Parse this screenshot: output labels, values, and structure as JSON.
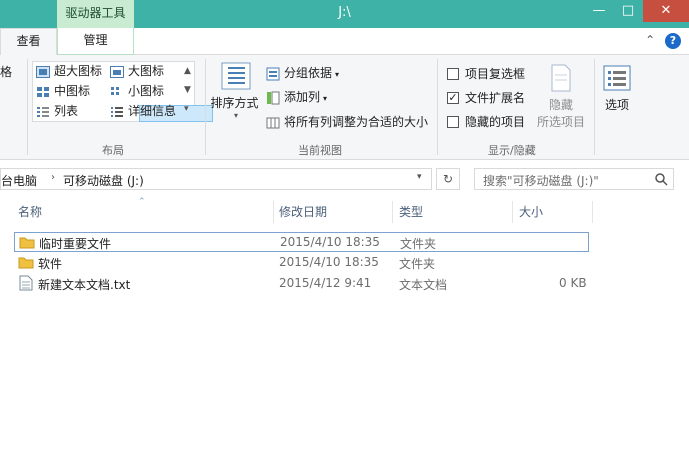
{
  "window": {
    "context_tab": "驱动器工具",
    "title": "J:\\",
    "minimize": "—",
    "maximize": "□",
    "close": "✕"
  },
  "tabs": [
    {
      "label": "查看"
    },
    {
      "label": "管理"
    }
  ],
  "ribbon_ctrls": {
    "collapse": "⌃",
    "help": "?"
  },
  "ribbon": {
    "pane_partial": "格",
    "layout": {
      "items": [
        "超大图标",
        "大图标",
        "中图标",
        "小图标",
        "列表",
        "详细信息"
      ],
      "group_label": "布局"
    },
    "current_view": {
      "sort_by": "排序方式",
      "group_by": "分组依据",
      "add_column": "添加列",
      "fit_columns": "将所有列调整为合适的大小",
      "group_label": "当前视图"
    },
    "show_hide": {
      "item_checkboxes": {
        "label": "项目复选框",
        "checked": false
      },
      "file_extensions": {
        "label": "文件扩展名",
        "checked": true
      },
      "hidden_items": {
        "label": "隐藏的项目",
        "checked": false
      },
      "hide_selected_line1": "隐藏",
      "hide_selected_line2": "所选项目",
      "group_label": "显示/隐藏"
    },
    "options": "选项"
  },
  "address": {
    "crumbs": [
      "台电脑",
      "可移动磁盘 (J:)"
    ],
    "search_placeholder": "搜索\"可移动磁盘 (J:)\""
  },
  "columns": [
    "名称",
    "修改日期",
    "类型",
    "大小"
  ],
  "files": [
    {
      "name": "临时重要文件",
      "date": "2015/4/10 18:35",
      "type": "文件夹",
      "size": "",
      "icon": "folder-icon"
    },
    {
      "name": "软件",
      "date": "2015/4/10 18:35",
      "type": "文件夹",
      "size": "",
      "icon": "folder-icon"
    },
    {
      "name": "新建文本文档.txt",
      "date": "2015/4/12 9:41",
      "type": "文本文档",
      "size": "0 KB",
      "icon": "text-file-icon"
    }
  ]
}
